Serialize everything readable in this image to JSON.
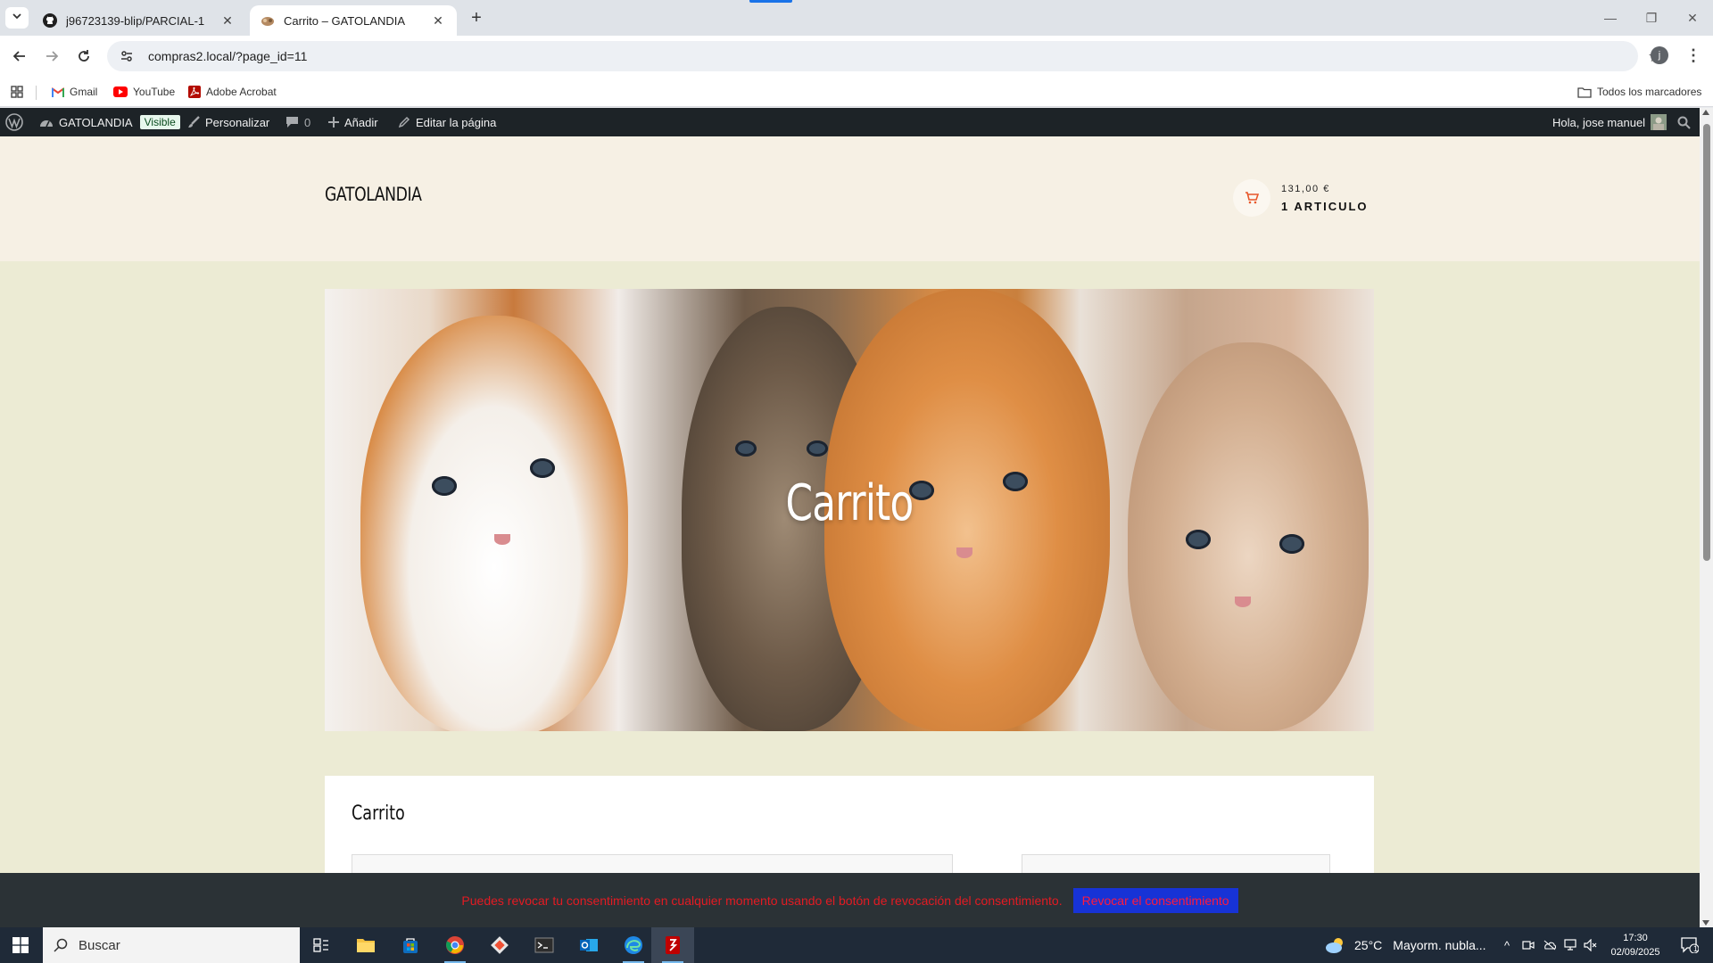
{
  "browser": {
    "tabs": [
      {
        "title": "j96723139-blip/PARCIAL-1",
        "icon": "github-icon",
        "active": false
      },
      {
        "title": "Carrito – GATOLANDIA",
        "icon": "site-favicon",
        "active": true
      }
    ],
    "url": "compras2.local/?page_id=11",
    "profile_initial": "j",
    "bookmarks": [
      {
        "label": "Gmail",
        "icon": "gmail-icon"
      },
      {
        "label": "YouTube",
        "icon": "youtube-icon"
      },
      {
        "label": "Adobe Acrobat",
        "icon": "acrobat-icon"
      }
    ],
    "all_bookmarks_label": "Todos los marcadores"
  },
  "wp_admin_bar": {
    "site_name": "GATOLANDIA",
    "visibility_badge": "Visible",
    "customize_label": "Personalizar",
    "comments_count": "0",
    "add_new_label": "Añadir",
    "edit_page_label": "Editar la página",
    "greeting": "Hola, jose manuel"
  },
  "site": {
    "title": "GATOLANDIA",
    "cart_price": "131,00 €",
    "cart_items": "1 ARTICULO",
    "hero_title": "Carrito",
    "content_heading": "Carrito"
  },
  "consent": {
    "message": "Puedes revocar tu consentimiento en cualquier momento usando el botón de revocación del consentimiento.",
    "button_label": "Revocar el consentimiento"
  },
  "taskbar": {
    "search_placeholder": "Buscar",
    "weather_temp": "25°C",
    "weather_desc": "Mayorm. nubla...",
    "time": "17:30",
    "date": "02/09/2025",
    "notification_count": "1"
  },
  "colors": {
    "wp_bar": "#1d2327",
    "header_bg": "#f6f0e4",
    "page_bg": "#ecebd4",
    "consent_text": "#e31b23",
    "consent_button_bg": "#1733d6",
    "cart_icon": "#e8572a"
  }
}
